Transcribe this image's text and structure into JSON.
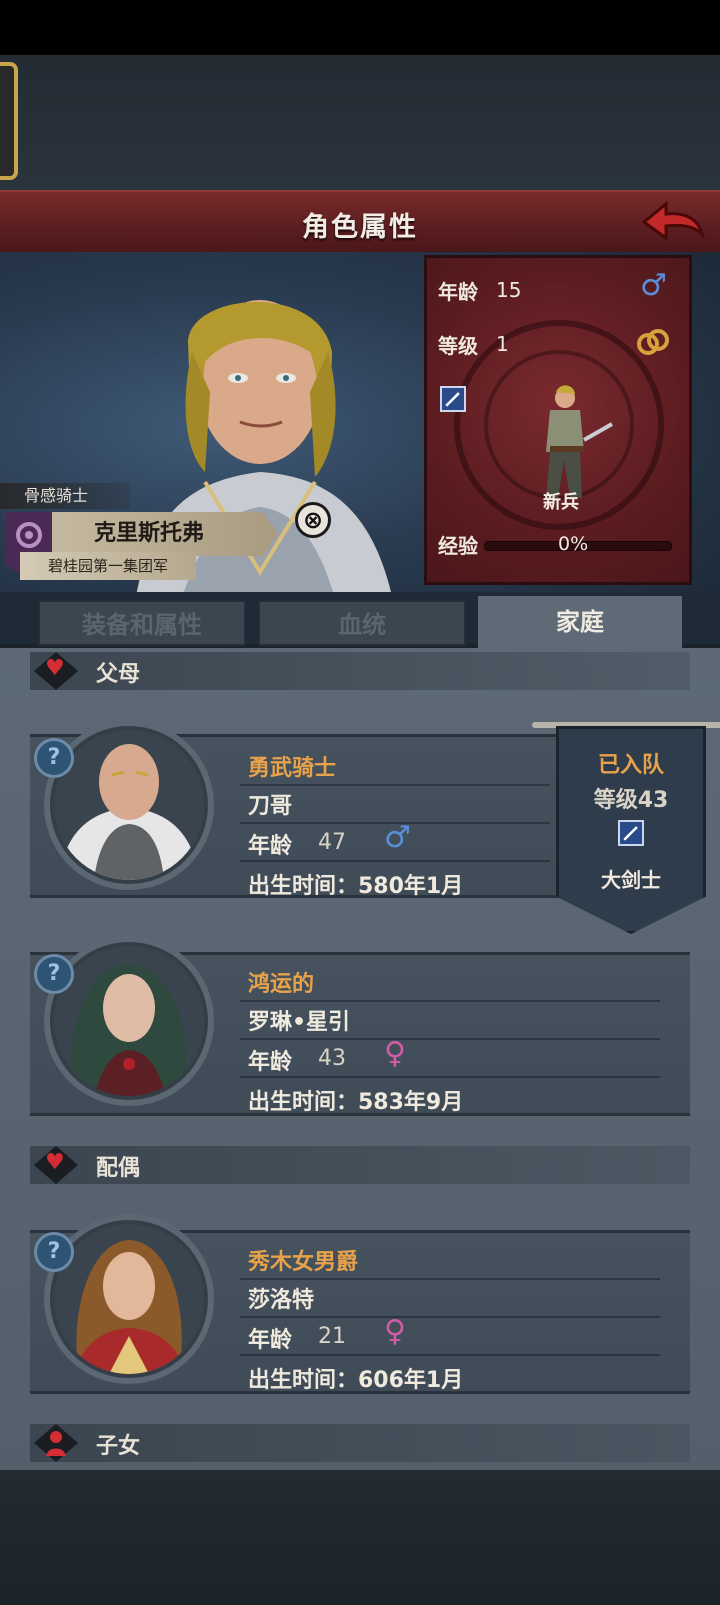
{
  "header": {
    "title": "角色属性"
  },
  "hero": {
    "title": "骨感骑士",
    "name": "克里斯托弗",
    "army": "碧桂园第一集团军"
  },
  "stats": {
    "age_label": "年龄",
    "age_value": "15",
    "level_label": "等级",
    "level_value": "1",
    "class_name": "新兵",
    "exp_label": "经验",
    "exp_value": "0%",
    "exp_fraction": 0
  },
  "tabs": [
    {
      "label": "装备和属性",
      "active": false
    },
    {
      "label": "血统",
      "active": false
    },
    {
      "label": "家庭",
      "active": true
    }
  ],
  "sections": {
    "parents": "父母",
    "spouse": "配偶",
    "children": "子女"
  },
  "members": [
    {
      "title": "勇武骑士",
      "name": "刀哥",
      "age_label": "年龄",
      "age": "47",
      "gender": "male",
      "birth": "出生时间：580年1月"
    },
    {
      "title": "鸿运的",
      "name": "罗琳•星引",
      "age_label": "年龄",
      "age": "43",
      "gender": "female",
      "birth": "出生时间：583年9月"
    },
    {
      "title": "秀木女男爵",
      "name": "莎洛特",
      "age_label": "年龄",
      "age": "21",
      "gender": "female",
      "birth": "出生时间：606年1月"
    }
  ],
  "party_badge": {
    "status": "已入队",
    "level": "等级43",
    "class_name": "大剑士"
  },
  "icons": {
    "male": "♂",
    "female": "♀",
    "question": "?",
    "close": "⊗"
  },
  "colors": {
    "header_red": "#5e1f22",
    "accent_orange": "#e8a24a",
    "male_blue": "#5a8fd8",
    "female_pink": "#d35aa6"
  }
}
